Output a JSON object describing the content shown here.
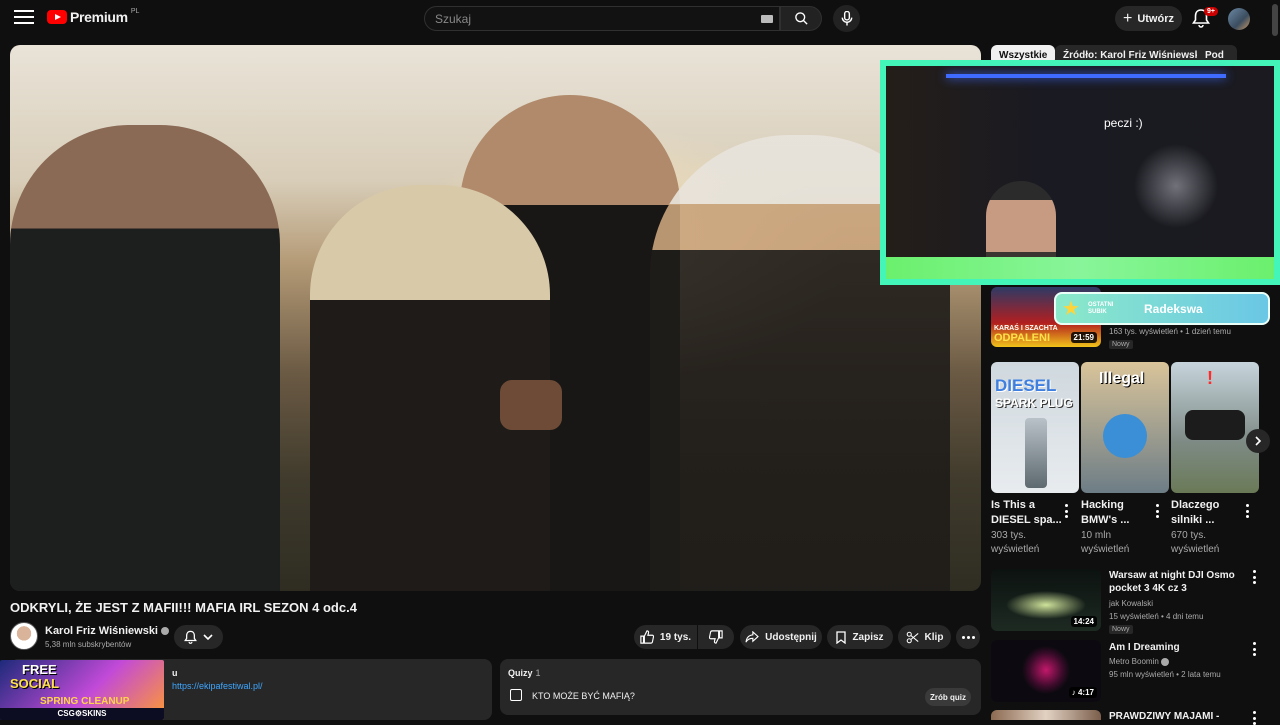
{
  "header": {
    "logo_text": "Premium",
    "country_code": "PL",
    "search_placeholder": "Szukaj",
    "create_label": "Utwórz",
    "notification_count": "9+"
  },
  "chips": [
    "Wszystkie",
    "Źródło: Karol Friz Wiśniewski",
    "Pod"
  ],
  "overlay": {
    "caption": "peczi :)",
    "plate_tag": "OSTATNI SUBIK",
    "plate_name": "Radekswa"
  },
  "video": {
    "title": "ODKRYLI, ŻE JEST Z MAFII!!! MAFIA IRL SEZON 4 odc.4",
    "channel": "Karol Friz Wiśniewski",
    "subscribers": "5,38 mln subskrybentów",
    "likes": "19 tys.",
    "share_label": "Udostępnij",
    "save_label": "Zapisz",
    "clip_label": "Klip"
  },
  "description": {
    "partial_text": "u",
    "link": "https://ekipafestiwal.pl/"
  },
  "quiz": {
    "header": "Quizy",
    "count": "1",
    "question": "KTO MOŻE BYĆ MAFIĄ?",
    "button": "Zrób quiz"
  },
  "promo": {
    "line1": "FREE",
    "line2": "SOCIAL",
    "line3": "SPRING CLEANUP",
    "line4": "CSG⚙SKINS"
  },
  "sidebar": {
    "top_video": {
      "thumb_text1": "KARAŚ I SZACHTA",
      "thumb_text2": "ODPALENI",
      "duration": "21:59",
      "meta": "163 tys. wyświetleń • 1 dzień temu",
      "badge": "Nowy"
    },
    "shorts": [
      {
        "thumb_top": "DIESEL",
        "thumb_sub": "SPARK PLUG",
        "title1": "Is This a",
        "title2": "DIESEL spa...",
        "views1": "303 tys.",
        "views2": "wyświetleń"
      },
      {
        "thumb_top": "Illegal",
        "title1": "Hacking",
        "title2": "BMW's ...",
        "views1": "10 mln",
        "views2": "wyświetleń"
      },
      {
        "title1": "Dlaczego",
        "title2": "silniki ...",
        "views1": "670 tys.",
        "views2": "wyświetleń"
      }
    ],
    "videos": [
      {
        "title1": "Warsaw at night  DJI Osmo",
        "title2": "pocket 3 4K cz  3",
        "channel": "jak Kowalski",
        "meta": "15 wyświetleń • 4 dni temu",
        "badge": "Nowy",
        "duration": "14:24"
      },
      {
        "title1": "Am I Dreaming",
        "channel": "Metro Boomin",
        "meta": "95 mln wyświetleń • 2 lata temu",
        "duration": "4:17"
      },
      {
        "title1": "PRAWDZIWY MAJAMI -"
      }
    ]
  }
}
